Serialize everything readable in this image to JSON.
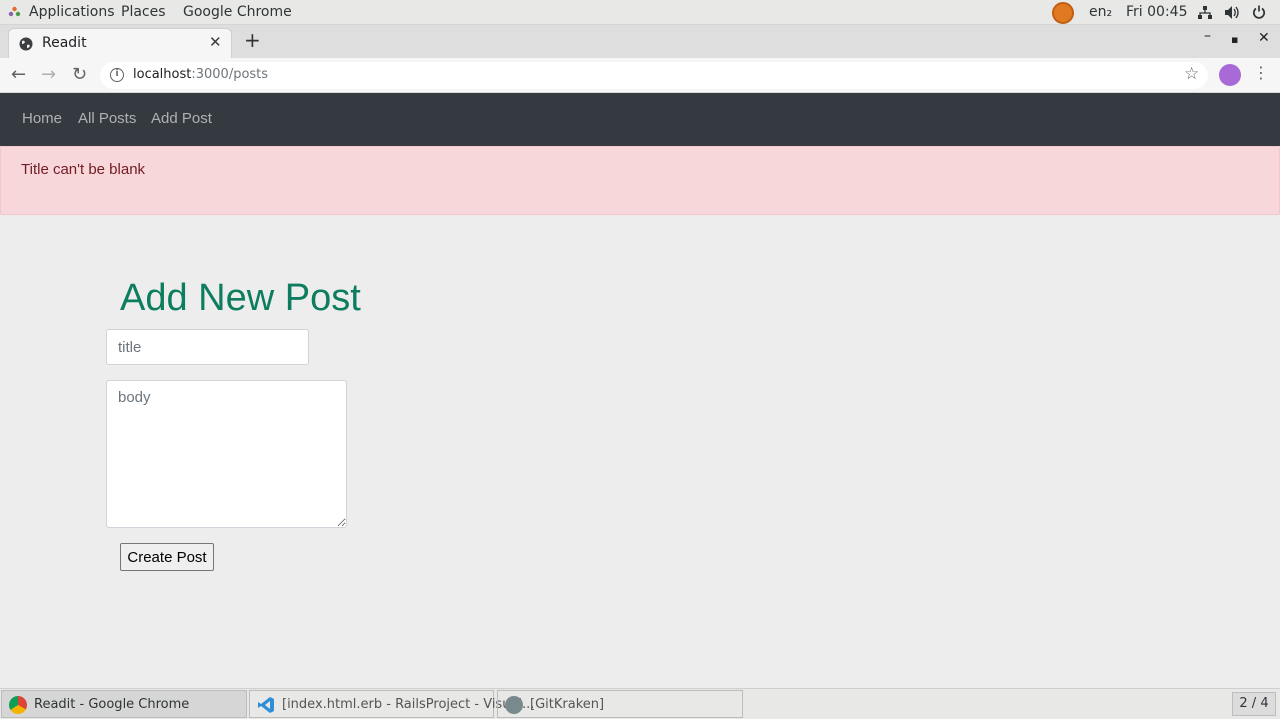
{
  "gnome": {
    "applications": "Applications",
    "places": "Places",
    "chrome": "Google Chrome",
    "lang": "en₂",
    "clock": "Fri 00:45"
  },
  "browser": {
    "tab_title": "Readit",
    "url_host": "localhost",
    "url_path": ":3000/posts"
  },
  "navbar": {
    "links": [
      "Home",
      "All Posts",
      "Add Post"
    ]
  },
  "alert": {
    "message": "Title can't be blank"
  },
  "form": {
    "heading": "Add New Post",
    "title_placeholder": "title",
    "body_placeholder": "body",
    "submit_label": "Create Post"
  },
  "taskbar": {
    "items": [
      "Readit - Google Chrome",
      "[index.html.erb - RailsProject - Visual...",
      "[GitKraken]"
    ],
    "workspace": "2 / 4"
  },
  "colors": {
    "navbar_bg": "#343a40",
    "alert_bg": "#f8d7da",
    "alert_text": "#721c24",
    "heading": "#0c7d5f"
  }
}
